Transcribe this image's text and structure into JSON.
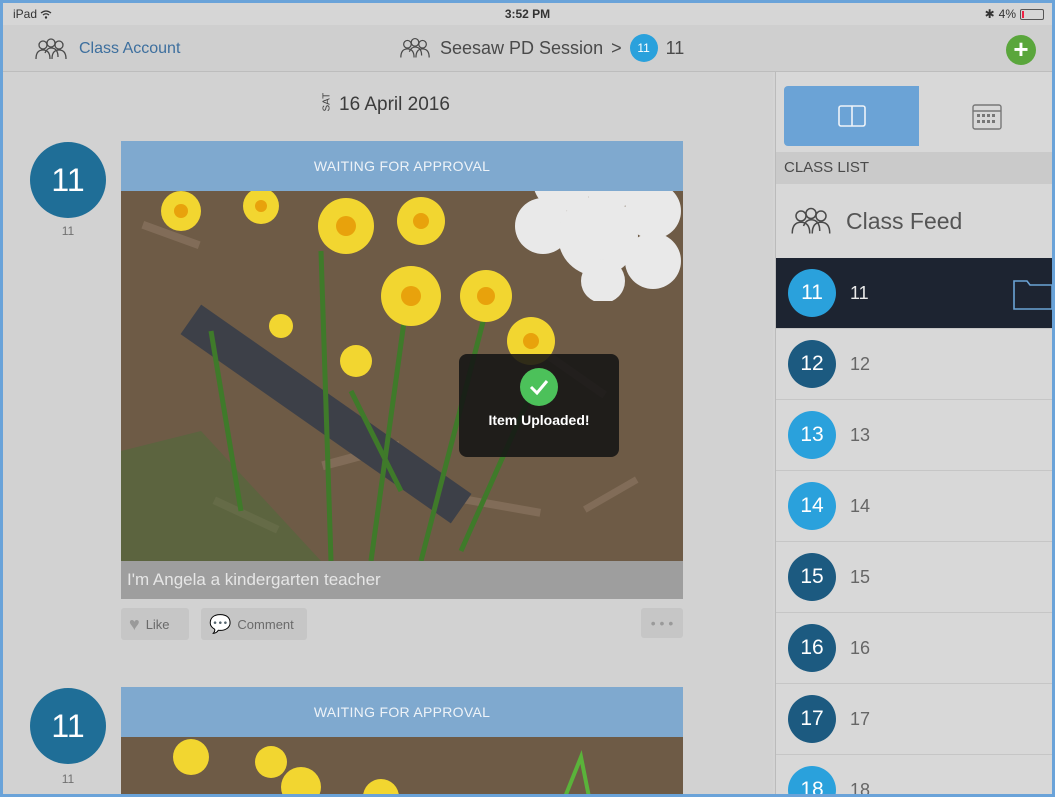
{
  "status_bar": {
    "device": "iPad",
    "wifi_icon": "wifi-icon",
    "time": "3:52 PM",
    "battery": "4%"
  },
  "nav": {
    "account_label": "Class Account",
    "class_name": "Seesaw PD Session",
    "separator": ">",
    "student_badge": "11",
    "student_label": "11",
    "add_icon": "plus-circle-icon"
  },
  "feed": {
    "date_dow": "SAT",
    "date": "16 April 2016",
    "posts": [
      {
        "avatar": "11",
        "avatar_label": "11",
        "status": "WAITING FOR APPROVAL",
        "caption": "I'm Angela a kindergarten teacher",
        "like_label": "Like",
        "comment_label": "Comment",
        "more_label": "• • •"
      },
      {
        "avatar": "11",
        "avatar_label": "11",
        "status": "WAITING FOR APPROVAL"
      }
    ],
    "toast": "Item Uploaded!"
  },
  "sidebar": {
    "list_header": "CLASS LIST",
    "class_feed_label": "Class Feed",
    "students": [
      {
        "num": "11",
        "name": "11",
        "color": "#2aa1dc",
        "selected": true
      },
      {
        "num": "12",
        "name": "12",
        "color": "#1c5a80"
      },
      {
        "num": "13",
        "name": "13",
        "color": "#2aa1dc"
      },
      {
        "num": "14",
        "name": "14",
        "color": "#2aa1dc"
      },
      {
        "num": "15",
        "name": "15",
        "color": "#1c5a80"
      },
      {
        "num": "16",
        "name": "16",
        "color": "#1c5a80"
      },
      {
        "num": "17",
        "name": "17",
        "color": "#1c5a80"
      },
      {
        "num": "18",
        "name": "18",
        "color": "#2aa1dc"
      }
    ]
  }
}
